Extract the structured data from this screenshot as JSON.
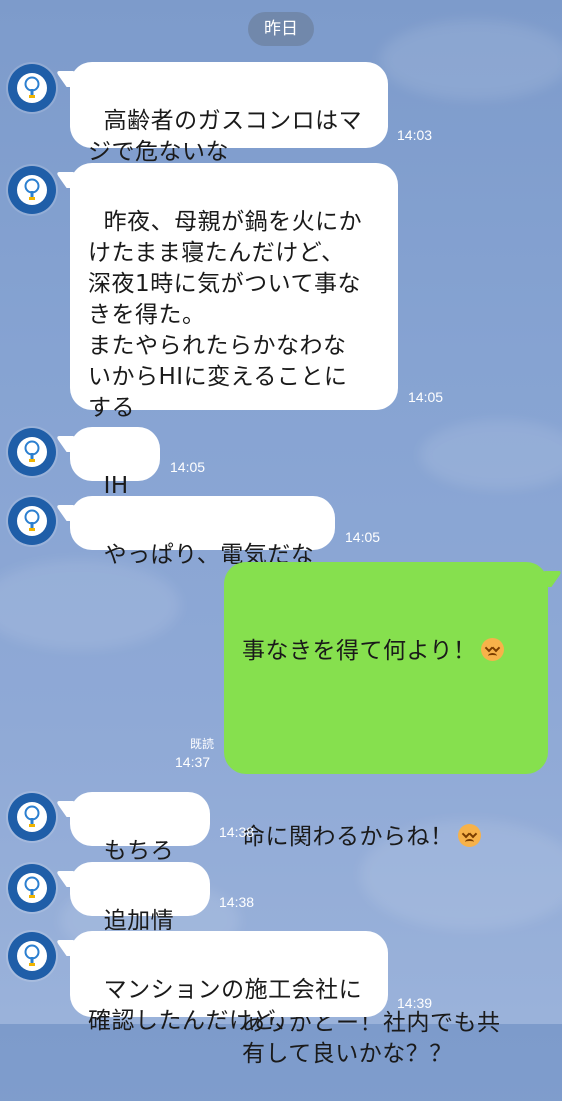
{
  "date_separator": "昨日",
  "read_receipt": "既読",
  "emoji_name": "persevering-face-emoji",
  "messages": [
    {
      "text": "高齢者のガスコンロはマ\nジで危ないな",
      "time": "14:03"
    },
    {
      "text": "昨夜、母親が鍋を火にか\nけたまま寝たんだけど、\n深夜1時に気がついて事な\nきを得た。\nまたやられたらかなわな\nいからHIに変えることに\nする",
      "time": "14:05"
    },
    {
      "text": "IHだ",
      "time": "14:05"
    },
    {
      "text": "やっぱり、電気だな",
      "time": "14:05"
    },
    {
      "line1": "事なきを得て何より！",
      "line2": "命に関わるからね！",
      "line3": "ありがとー！社内でも共\n有して良いかな？？",
      "time": "14:37"
    },
    {
      "text": "もちろん",
      "time": "14:38"
    },
    {
      "text": "追加情報",
      "time": "14:38"
    },
    {
      "text": "マンションの施工会社に\n確認したんだけど、",
      "time": "14:39"
    }
  ]
}
